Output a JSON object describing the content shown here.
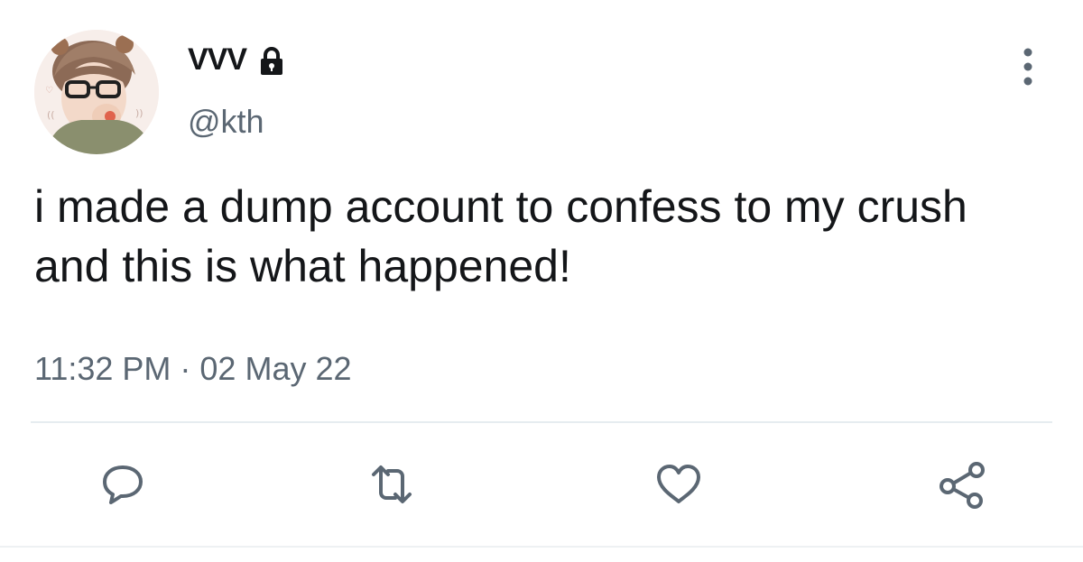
{
  "author": {
    "display_name": "VVV",
    "handle": "@kth",
    "protected": true,
    "avatar_icon": "user-photo-avatar",
    "lock_icon": "lock-icon"
  },
  "tweet": {
    "text": "i made a dump account to confess to my crush and this is what happened!",
    "timestamp": "11:32 PM · 02 May 22"
  },
  "actions": [
    {
      "name": "reply",
      "icon": "reply-icon"
    },
    {
      "name": "retweet",
      "icon": "retweet-icon"
    },
    {
      "name": "like",
      "icon": "heart-icon"
    },
    {
      "name": "share",
      "icon": "share-icon"
    }
  ],
  "menu_icon": "more-options-icon",
  "colors": {
    "text": "#141619",
    "secondary": "#5b6773",
    "divider": "#e6ecf0"
  }
}
